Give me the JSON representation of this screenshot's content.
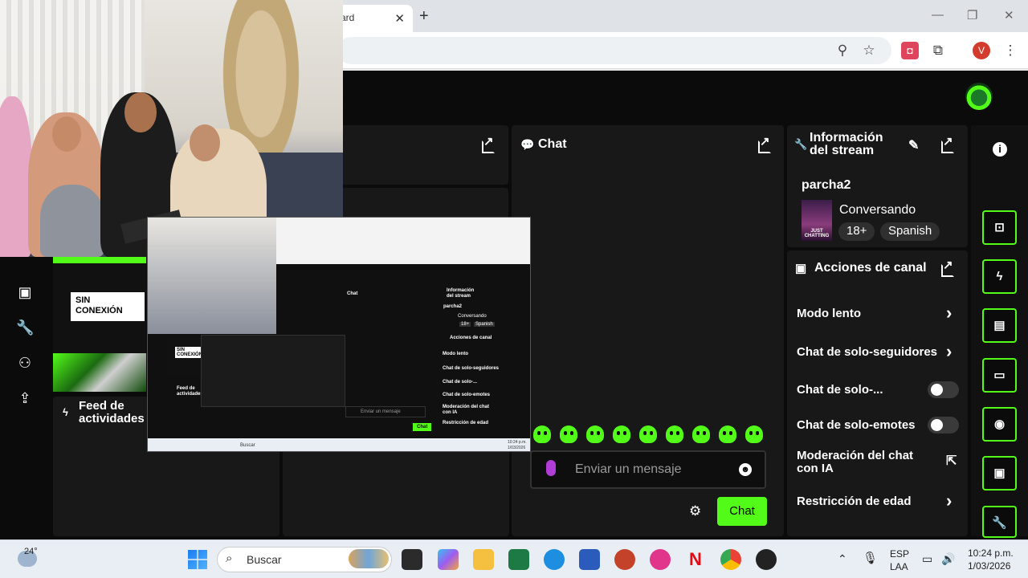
{
  "browser": {
    "tab_title": "ard",
    "tab_close": "✕",
    "new_tab": "+",
    "minimize": "—",
    "restore": "❐",
    "close": "✕",
    "profile_initial": "V"
  },
  "webcam": {
    "sin_conexion": "SIN\nCONEXIÓN"
  },
  "panels": {
    "chat_title": "Chat",
    "feed_title": "Feed de\nactividades",
    "stream_info_title": "Información\ndel stream",
    "channel_actions_title": "Acciones de canal"
  },
  "stream_info": {
    "channel": "parcha2",
    "category": "Conversando",
    "thumb_text": "JUST\nCHATTING",
    "tags": [
      "18+",
      "Spanish"
    ]
  },
  "channel_actions": {
    "items": [
      {
        "label": "Modo lento",
        "control": "chevron"
      },
      {
        "label": "Chat de solo-seguidores",
        "control": "chevron"
      },
      {
        "label": "Chat de solo-...",
        "control": "toggle"
      },
      {
        "label": "Chat de solo-emotes",
        "control": "toggle"
      },
      {
        "label": "Moderación del chat\ncon IA",
        "control": "external"
      },
      {
        "label": "Restricción de edad",
        "control": "chevron"
      }
    ]
  },
  "chat": {
    "placeholder": "Enviar un mensaje",
    "send_label": "Chat"
  },
  "nested": {
    "chat": "Chat",
    "info": "Información\ndel stream",
    "channel": "parcha2",
    "category": "Conversando",
    "tags": [
      "18+",
      "Spanish"
    ],
    "actions_title": "Acciones de canal",
    "actions": [
      "Modo lento",
      "Chat de solo-seguidores",
      "Chat de solo-...",
      "Chat de solo-emotes",
      "Moderación del chat\ncon IA",
      "Restricción de edad"
    ],
    "sin_conexion": "SIN\nCONEXIÓN",
    "feed": "Feed de\nactividades",
    "placeholder": "Enviar un mensaje",
    "send": "Chat",
    "search": "Buscar",
    "time": "10:24 p.m.",
    "date": "1/03/2026"
  },
  "taskbar": {
    "weather": "24°",
    "search_label": "Buscar",
    "lang_top": "ESP",
    "lang_bottom": "LAA",
    "time": "10:24 p.m.",
    "date": "1/03/2026"
  },
  "colors": {
    "accent": "#53fc18",
    "panel_bg": "#181818",
    "app_bg": "#0b0b0b"
  }
}
